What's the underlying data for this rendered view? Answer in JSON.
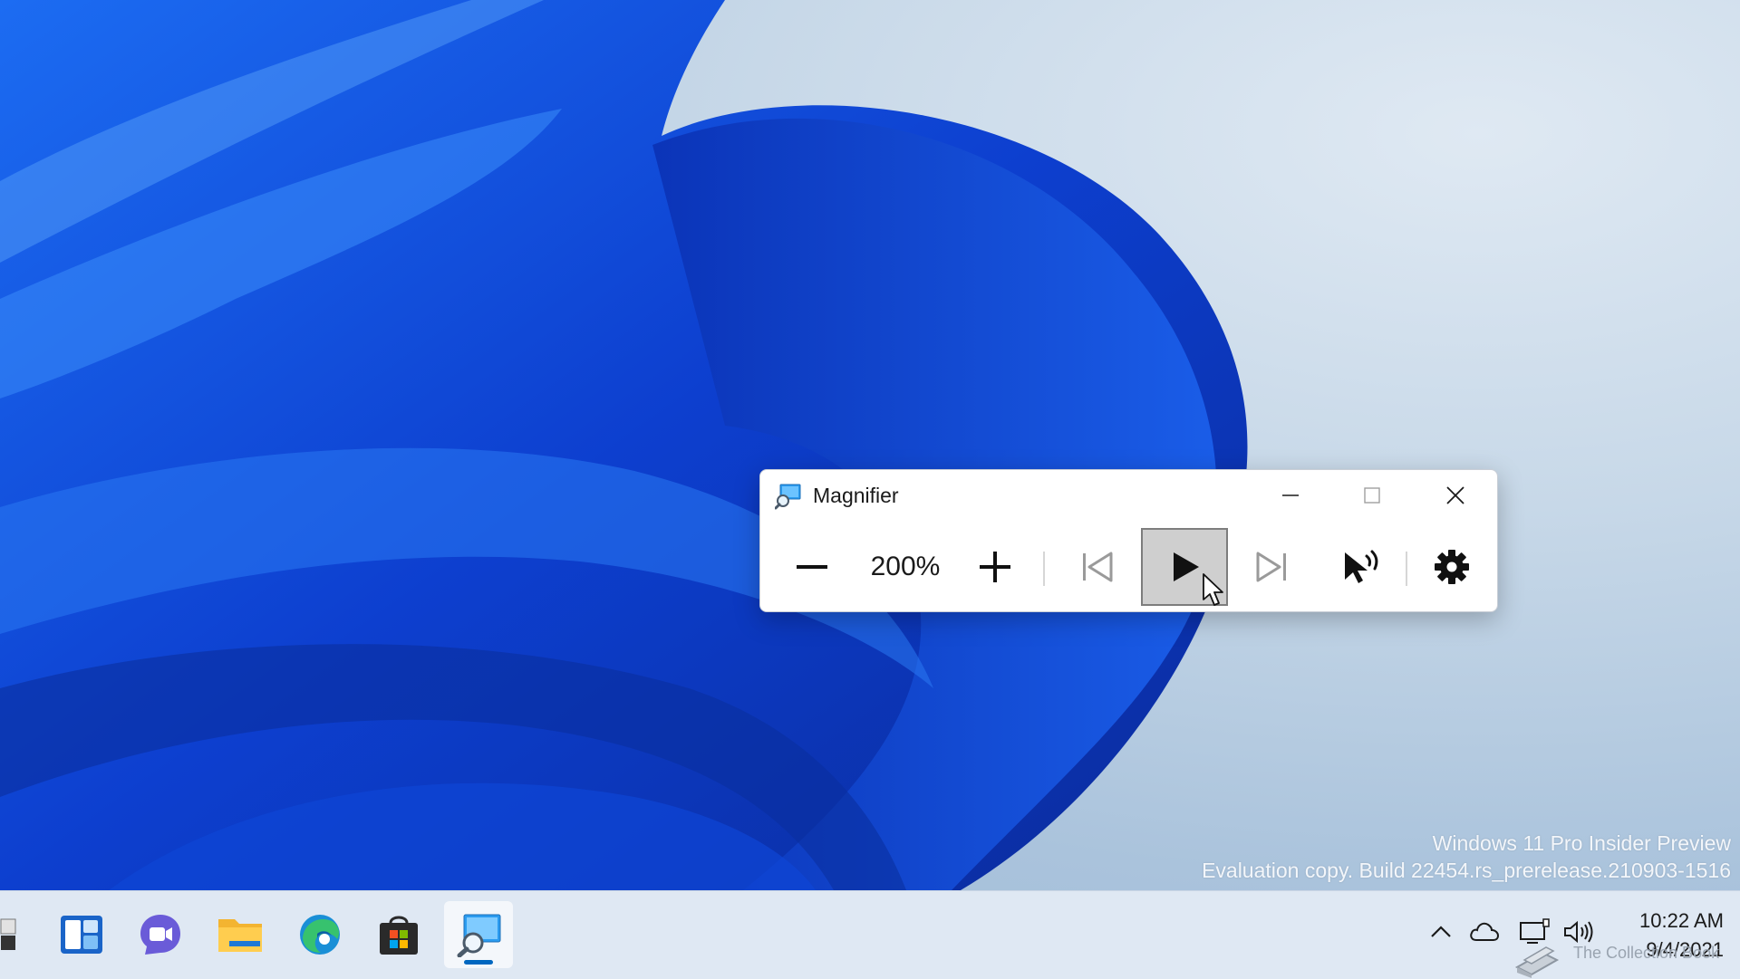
{
  "desktop": {
    "watermark_line1": "Windows 11 Pro Insider Preview",
    "watermark_line2": "Evaluation copy. Build 22454.rs_prerelease.210903-1516"
  },
  "magnifier": {
    "title": "Magnifier",
    "app_icon": "magnifier-app-icon",
    "zoom_level": "200%",
    "buttons": {
      "zoom_out": "minus-icon",
      "zoom_in": "plus-icon",
      "previous": "skip-previous-icon",
      "play": "play-icon",
      "next": "skip-next-icon",
      "read_from_here": "read-aloud-icon",
      "settings": "gear-icon"
    },
    "window_controls": [
      "minimize",
      "maximize",
      "close"
    ]
  },
  "taskbar": {
    "apps": [
      {
        "name": "Widgets",
        "icon": "widgets-icon"
      },
      {
        "name": "Chat",
        "icon": "teams-chat-icon"
      },
      {
        "name": "File Explorer",
        "icon": "folder-icon"
      },
      {
        "name": "Microsoft Edge",
        "icon": "edge-icon"
      },
      {
        "name": "Microsoft Store",
        "icon": "store-icon"
      },
      {
        "name": "Magnifier",
        "icon": "magnifier-app-icon",
        "active": true
      }
    ],
    "tray": [
      "chevron-up-icon",
      "onedrive-cloud-icon",
      "network-icon",
      "volume-icon"
    ],
    "time": "10:22 AM",
    "date": "9/4/2021"
  },
  "branding": {
    "text": "The Collection Book"
  },
  "colors": {
    "accent": "#0067c0",
    "wallpaper_blue": "#1043d6",
    "window_bg": "#ffffff"
  }
}
